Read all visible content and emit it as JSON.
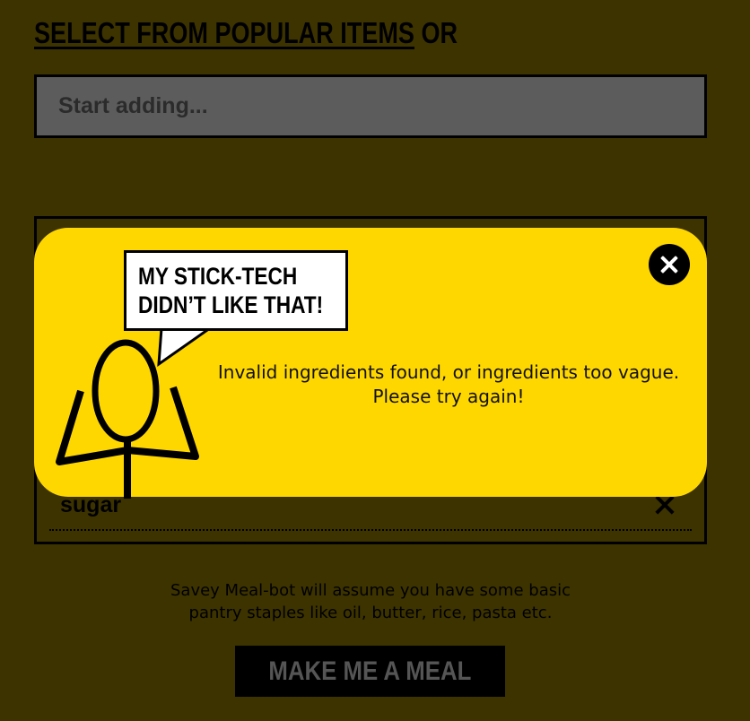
{
  "heading": {
    "link_text": "SELECT FROM POPULAR ITEMS",
    "suffix": "OR"
  },
  "search": {
    "placeholder": "Start adding..."
  },
  "ingredients": {
    "items": [
      {
        "label": "sugar"
      }
    ]
  },
  "modal": {
    "speech_line1": "MY STICK-TECH",
    "speech_line2": "DIDN’T LIKE THAT!",
    "message_line1": "Invalid ingredients found, or ingredients too vague.",
    "message_line2": "Please try again!",
    "close_icon": "close-icon"
  },
  "note": {
    "line1": "Savey Meal-bot will assume you have some basic",
    "line2": "pantry staples like oil, butter, rice, pasta etc."
  },
  "cta": {
    "label": "MAKE ME A MEAL"
  },
  "colors": {
    "background": "#3d3300",
    "modal": "#ffd700",
    "input": "#5c5c5c",
    "cta_text": "#555555"
  }
}
